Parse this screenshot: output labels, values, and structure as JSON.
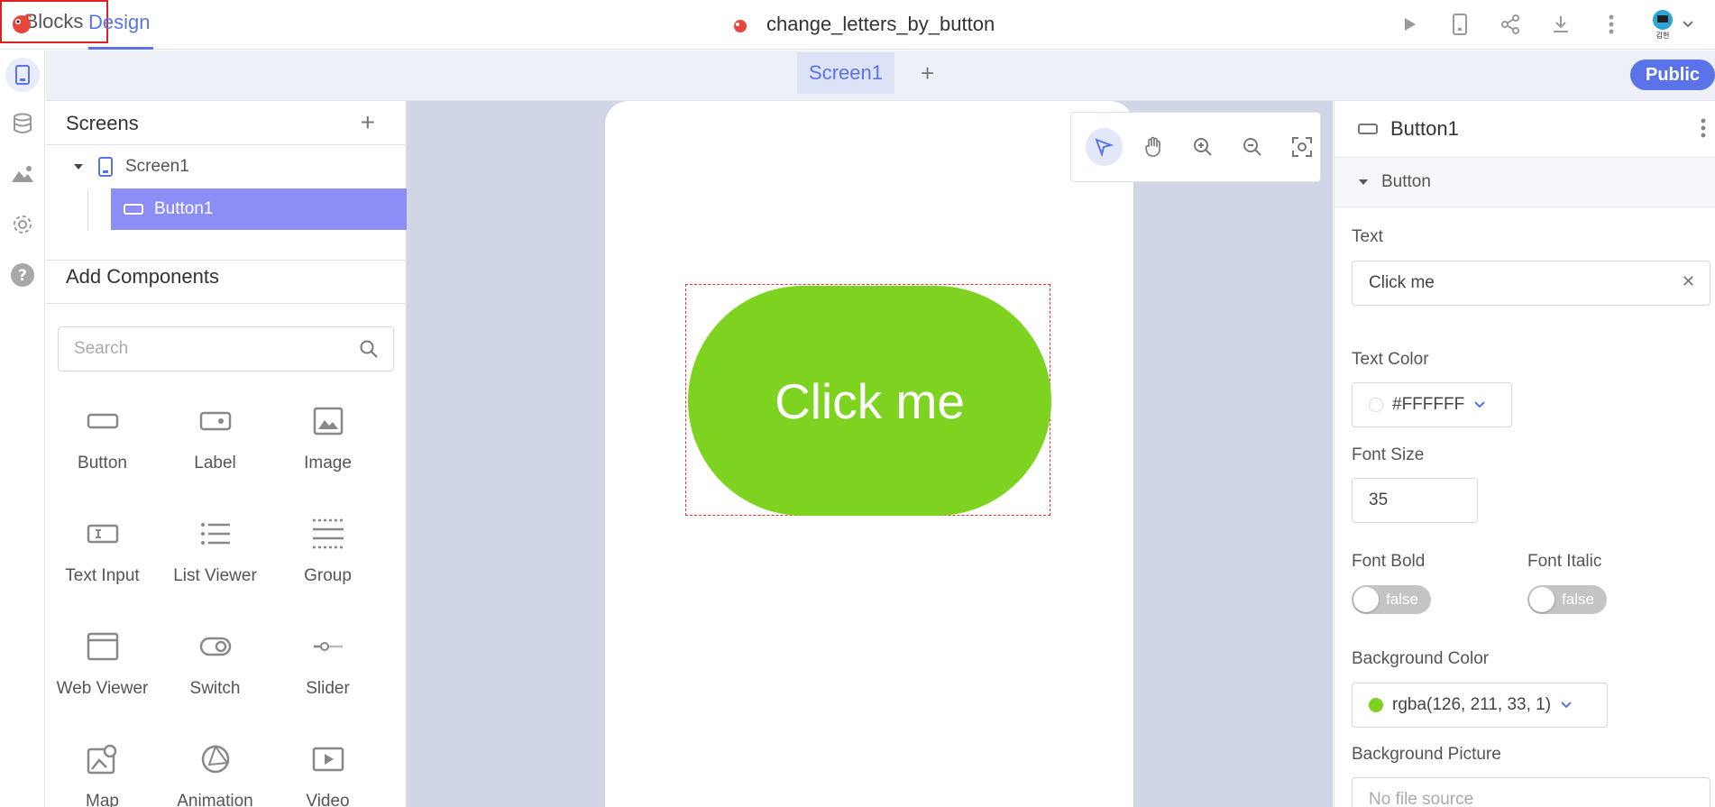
{
  "header": {
    "tabs": {
      "design": "Design",
      "blocks": "Blocks"
    },
    "project_title": "change_letters_by_button",
    "avatar_text": "김헌"
  },
  "screens_bar": {
    "active_screen": "Screen1",
    "add_label": "+",
    "public_label": "Public"
  },
  "left_panel": {
    "screens_title": "Screens",
    "screens_add": "+",
    "tree": {
      "screen": "Screen1",
      "component": "Button1"
    },
    "add_components_title": "Add Components",
    "search_placeholder": "Search",
    "components": [
      "Button",
      "Label",
      "Image",
      "Text Input",
      "List Viewer",
      "Group",
      "Web Viewer",
      "Switch",
      "Slider",
      "Map",
      "Animation",
      "Video"
    ]
  },
  "canvas": {
    "button_text": "Click me",
    "button_color": "#7ED321"
  },
  "properties": {
    "component_name": "Button1",
    "section": "Button",
    "text_label": "Text",
    "text_value": "Click me",
    "text_color_label": "Text Color",
    "text_color_value": "#FFFFFF",
    "font_size_label": "Font Size",
    "font_size_value": "35",
    "font_bold_label": "Font Bold",
    "font_bold_value": "false",
    "font_italic_label": "Font Italic",
    "font_italic_value": "false",
    "bg_color_label": "Background Color",
    "bg_color_value": "rgba(126, 211, 33, 1)",
    "bg_picture_label": "Background Picture",
    "bg_picture_placeholder": "No file source"
  },
  "colors": {
    "accent": "#5b73e8",
    "selected_tree": "#8c8ef5",
    "button_green": "#7ed321"
  }
}
